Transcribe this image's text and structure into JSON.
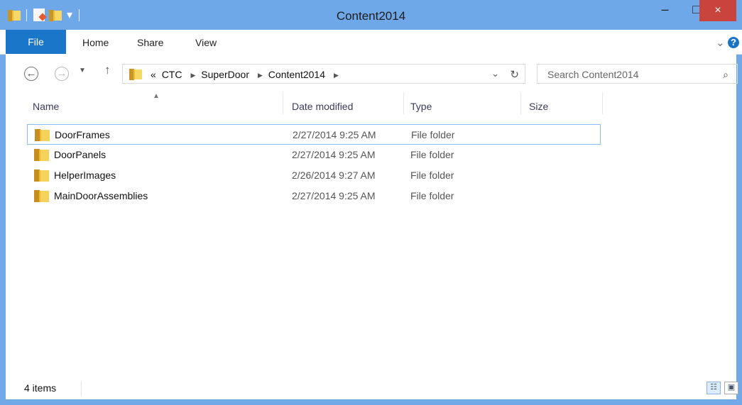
{
  "window": {
    "title": "Content2014",
    "controls": {
      "minimize": "–",
      "maximize": "□",
      "close": "×"
    }
  },
  "ribbon": {
    "tabs": [
      "File",
      "Home",
      "Share",
      "View"
    ],
    "collapse_icon": "chevron-down",
    "help_label": "?"
  },
  "navigation": {
    "back_icon": "left-arrow",
    "forward_icon": "right-arrow",
    "recent_icon": "chevron-down",
    "up_icon": "up-arrow",
    "breadcrumbs": [
      "«",
      "CTC",
      "SuperDoor",
      "Content2014"
    ],
    "search_placeholder": "Search Content2014"
  },
  "columns": {
    "name": "Name",
    "date_modified": "Date modified",
    "type": "Type",
    "size": "Size"
  },
  "items": [
    {
      "name": "DoorFrames",
      "date_modified": "2/27/2014 9:25 AM",
      "type": "File folder"
    },
    {
      "name": "DoorPanels",
      "date_modified": "2/27/2014 9:25 AM",
      "type": "File folder"
    },
    {
      "name": "HelperImages",
      "date_modified": "2/26/2014 9:27 AM",
      "type": "File folder"
    },
    {
      "name": "MainDoorAssemblies",
      "date_modified": "2/27/2014 9:25 AM",
      "type": "File folder"
    }
  ],
  "status": {
    "item_count": "4 items"
  },
  "colors": {
    "title_bar": "#6fa8e9",
    "file_tab": "#1976c8",
    "close_button": "#c9443c",
    "selection_border": "#8cbcf2"
  }
}
